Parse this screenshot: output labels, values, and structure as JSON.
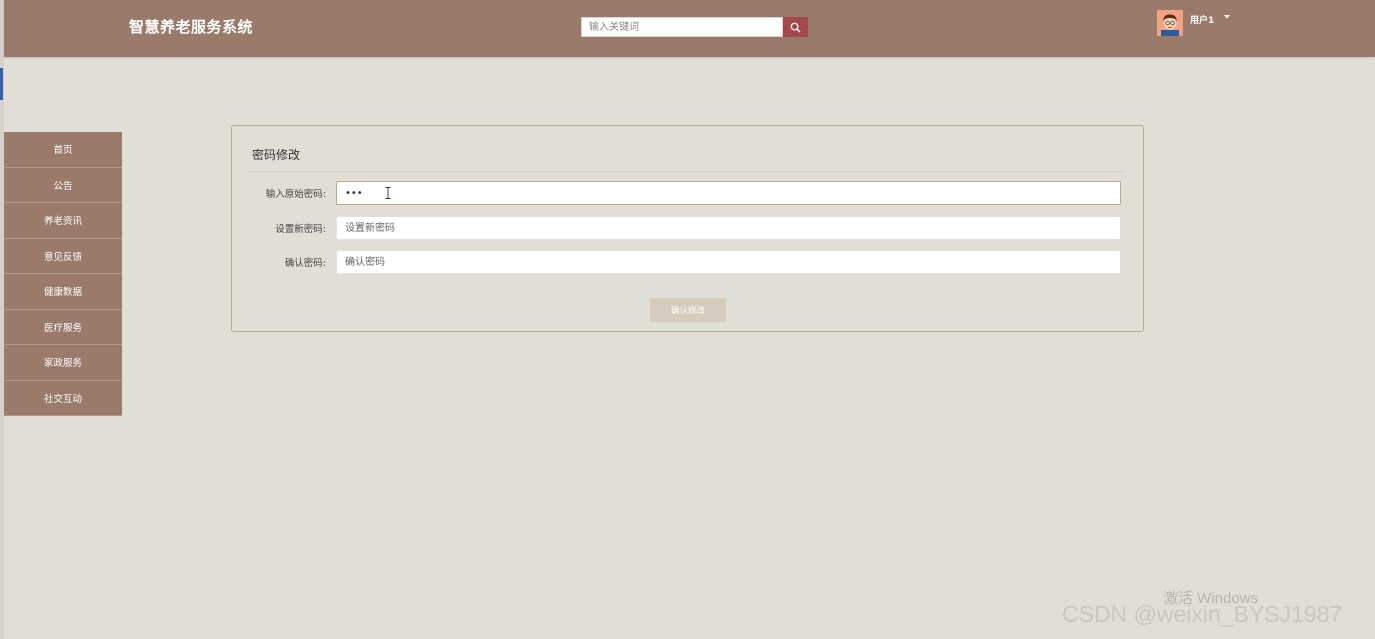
{
  "header": {
    "brand": "智慧养老服务系统",
    "search_placeholder": "输入关键词",
    "user_name": "用户1"
  },
  "sidebar": {
    "items": [
      {
        "label": "首页"
      },
      {
        "label": "公告"
      },
      {
        "label": "养老资讯"
      },
      {
        "label": "意见反馈"
      },
      {
        "label": "健康数据"
      },
      {
        "label": "医疗服务"
      },
      {
        "label": "家政服务"
      },
      {
        "label": "社交互动"
      }
    ]
  },
  "form": {
    "title": "密码修改",
    "fields": [
      {
        "label": "输入原始密码:",
        "value": "•••",
        "placeholder": ""
      },
      {
        "label": "设置新密码:",
        "value": "",
        "placeholder": "设置新密码"
      },
      {
        "label": "确认密码:",
        "value": "",
        "placeholder": "确认密码"
      }
    ],
    "submit_label": "确认修改"
  },
  "watermarks": {
    "windows": "激活 Windows",
    "csdn": "CSDN @weixin_BYSJ1987"
  },
  "colors": {
    "header_bg": "#9a7b6b",
    "page_bg": "#e1ded6",
    "search_button": "#a4484b",
    "submit_button": "#d6ccbd"
  }
}
